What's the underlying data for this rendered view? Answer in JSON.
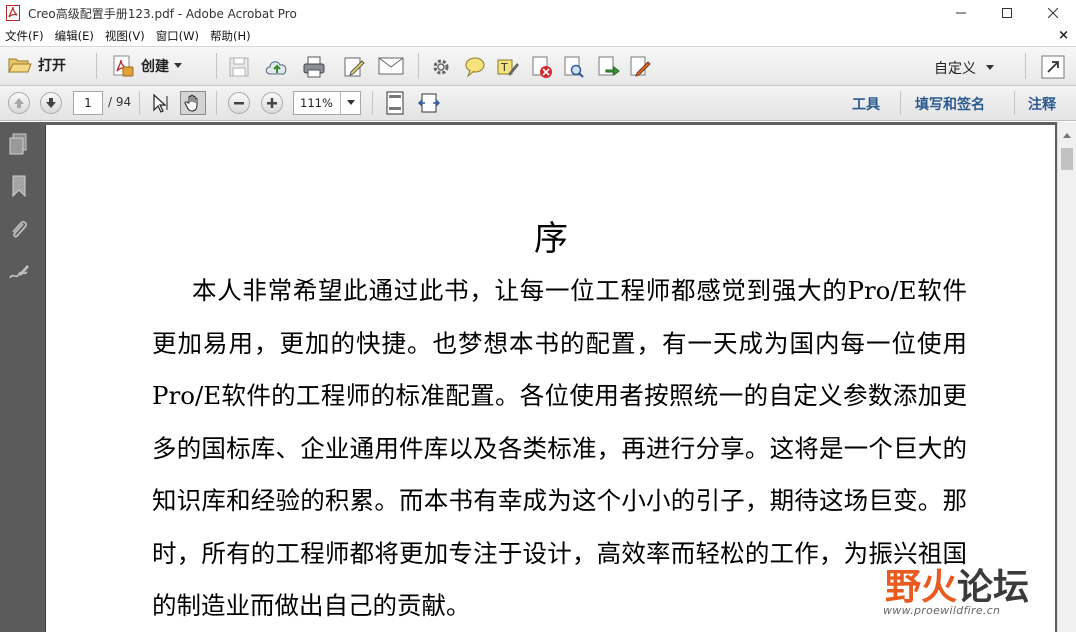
{
  "window": {
    "title": "Creo高级配置手册123.pdf - Adobe Acrobat Pro"
  },
  "menubar": {
    "items": [
      "文件(F)",
      "编辑(E)",
      "视图(V)",
      "窗口(W)",
      "帮助(H)"
    ],
    "close_doc_glyph": "×"
  },
  "toolbar": {
    "open_label": "打开",
    "create_label": "创建",
    "customize_label": "自定义"
  },
  "nav": {
    "current_page": "1",
    "total_pages": "/ 94",
    "zoom": "111%"
  },
  "panels": {
    "tools": "工具",
    "fill_sign": "填写和签名",
    "comment": "注释"
  },
  "document": {
    "title": "序",
    "paragraph": "本人非常希望此通过此书，让每一位工程师都感觉到强大的Pro/E软件更加易用，更加的快捷。也梦想本书的配置，有一天成为国内每一位使用Pro/E软件的工程师的标准配置。各位使用者按照统一的自定义参数添加更多的国标库、企业通用件库以及各类标准，再进行分享。这将是一个巨大的知识库和经验的积累。而本书有幸成为这个小小的引子，期待这场巨变。那时，所有的工程师都将更加专注于设计，高效率而轻松的工作，为振兴祖国的制造业而做出自己的贡献。"
  },
  "watermark": {
    "cn_part1": "野火",
    "cn_part2": "论坛",
    "url": "www.proewildfire.cn"
  },
  "colors": {
    "link_blue": "#2c5a8e",
    "left_pane": "#5b5b5b",
    "doc_bg": "#5e5e5e"
  }
}
